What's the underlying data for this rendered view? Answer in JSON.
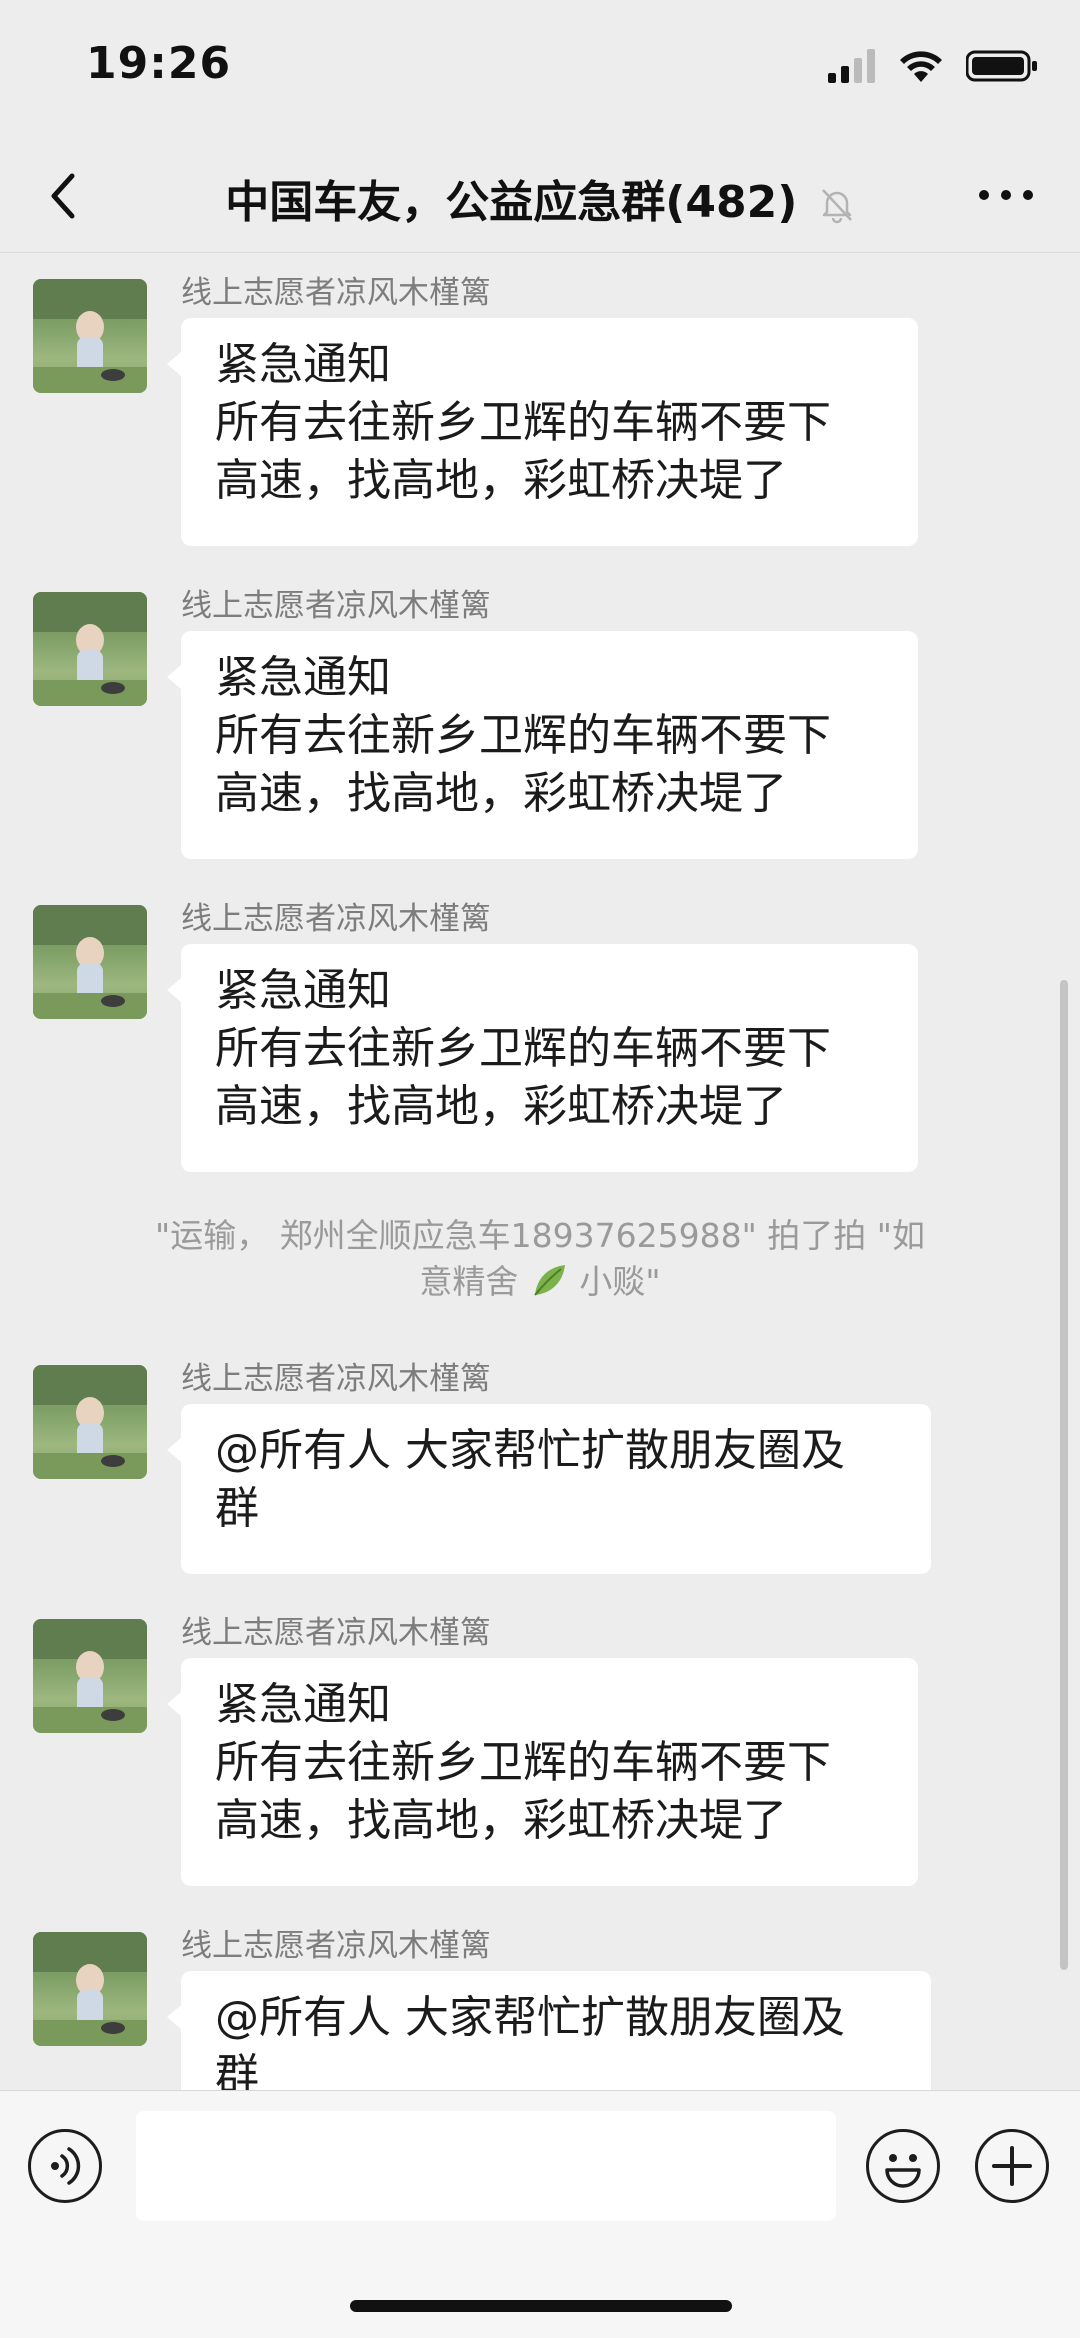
{
  "status_bar": {
    "time": "19:26",
    "icons": [
      "signal-icon",
      "wifi-icon",
      "battery-icon"
    ]
  },
  "header": {
    "title": "中国车友，公益应急群(482)",
    "back_icon": "chevron-left-icon",
    "mute_icon": "bell-muted-icon",
    "more_icon": "more-icon"
  },
  "messages": [
    {
      "sender": "线上志愿者凉风木槿篱",
      "text": "紧急通知\n所有去往新乡卫辉的车辆不要下\n高速，找高地，彩虹桥决堤了"
    },
    {
      "sender": "线上志愿者凉风木槿篱",
      "text": "紧急通知\n所有去往新乡卫辉的车辆不要下\n高速，找高地，彩虹桥决堤了"
    },
    {
      "sender": "线上志愿者凉风木槿篱",
      "text": "紧急通知\n所有去往新乡卫辉的车辆不要下\n高速，找高地，彩虹桥决堤了"
    },
    {
      "sender": "线上志愿者凉风木槿篱",
      "text": "@所有人 大家帮忙扩散朋友圈及\n群"
    },
    {
      "sender": "线上志愿者凉风木槿篱",
      "text": "紧急通知\n所有去往新乡卫辉的车辆不要下\n高速，找高地，彩虹桥决堤了"
    },
    {
      "sender": "线上志愿者凉风木槿篱",
      "text": "@所有人 大家帮忙扩散朋友圈及\n群"
    }
  ],
  "system_message": {
    "line1": "\"运输， 郑州全顺应急车18937625988\" 拍了拍 \"如",
    "line2_before": "意精舍",
    "line2_after": "小赕\"",
    "emoji_icon": "leaf-icon"
  },
  "input_bar": {
    "voice_icon": "voice-icon",
    "input_value": "",
    "emoji_icon": "smiley-icon",
    "plus_icon": "plus-icon"
  },
  "colors": {
    "background": "#ededed",
    "bubble": "#ffffff",
    "sender_text": "#7d7d7d",
    "system_text": "#9a9a9a"
  }
}
